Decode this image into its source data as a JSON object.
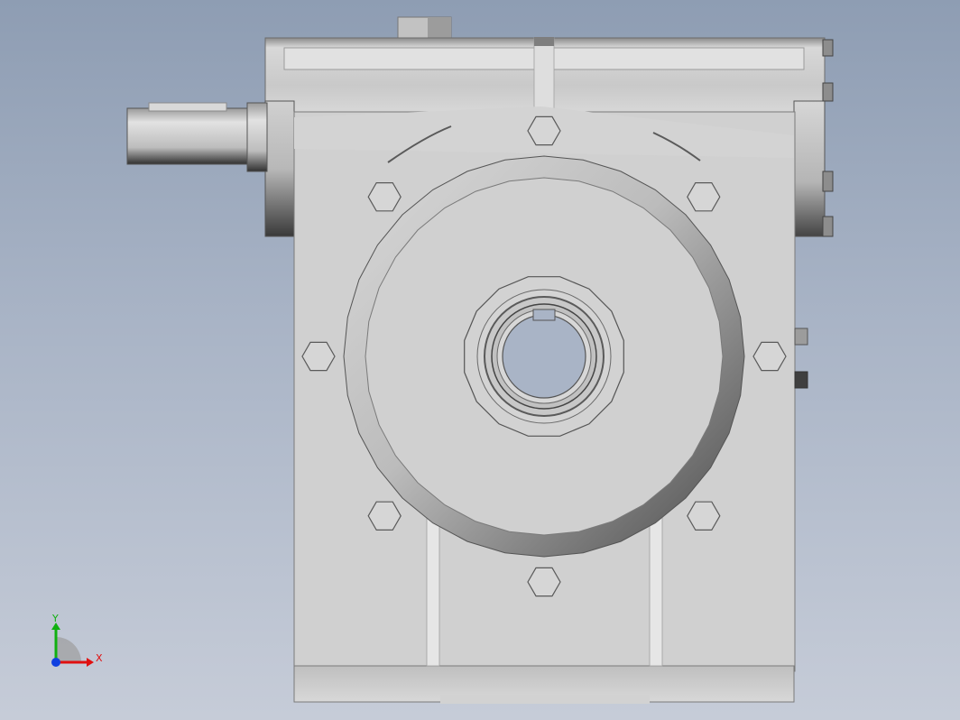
{
  "app": {
    "view": "Front",
    "background_top": "#8e9db3",
    "background_bottom": "#c6ccd8"
  },
  "model": {
    "type": "worm-gear-reducer",
    "housing_color": "#cfcfcf",
    "shadow_color": "#5c5c5c",
    "bore_color": "#a9b4c6",
    "flange_bolt_count": 8
  },
  "triad": {
    "x_label": "X",
    "y_label": "Y",
    "x_color": "#e01010",
    "y_color": "#10b010",
    "z_color": "#1040e0"
  }
}
